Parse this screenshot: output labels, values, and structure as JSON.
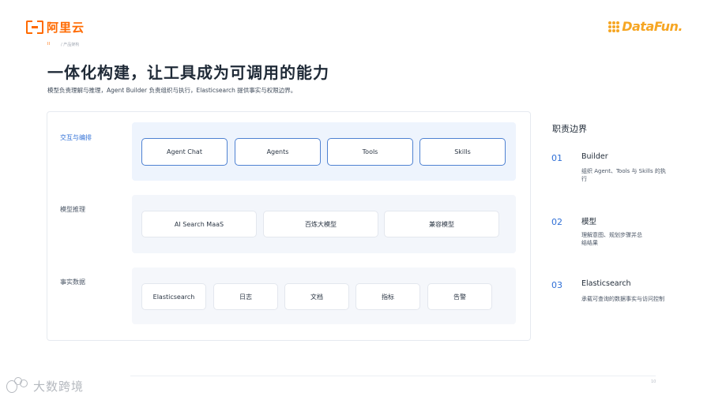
{
  "header": {
    "aliyun_logo_text": "阿里云",
    "datafun_logo_text": "DataFun.",
    "breadcrumb_num": "II",
    "breadcrumb_label": "/ 产品架构"
  },
  "title": "一体化构建，让工具成为可调用的能力",
  "subtitle": "模型负责理解与推理，Agent Builder 负责组织与执行，Elasticsearch 提供事实与权限边界。",
  "layers": [
    {
      "label": "交互与编排",
      "items": [
        "Agent Chat",
        "Agents",
        "Tools",
        "Skills"
      ]
    },
    {
      "label": "模型推理",
      "items": [
        "AI Search MaaS",
        "百炼大模型",
        "兼容模型"
      ]
    },
    {
      "label": "事实数据",
      "items": [
        "Elasticsearch",
        "日志",
        "文档",
        "指标",
        "告警"
      ]
    }
  ],
  "side": {
    "title": "职责边界",
    "items": [
      {
        "num": "01",
        "head": "Builder",
        "desc": "组织 Agent、Tools 与 Skills 的执行"
      },
      {
        "num": "02",
        "head": "模型",
        "desc": "理解意图、规划步骤并总结结果"
      },
      {
        "num": "03",
        "head": "Elasticsearch",
        "desc": "承载可查询的数据事实与访问控制"
      }
    ]
  },
  "footer": {
    "page_num": "10",
    "watermark_text": "大数跨境"
  },
  "colors": {
    "accent": "#2f6fd6",
    "brand_orange": "#ff6a00",
    "datafun_orange": "#f6a623",
    "panel_bg": "#eef4fd"
  }
}
